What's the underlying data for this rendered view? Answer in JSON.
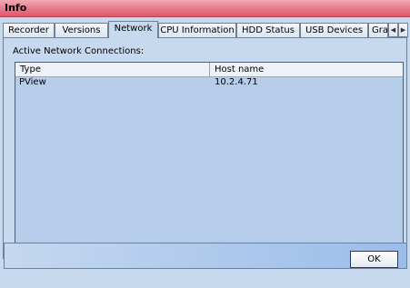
{
  "window": {
    "title": "Info"
  },
  "tabs": [
    {
      "label": "Recorder"
    },
    {
      "label": "Versions"
    },
    {
      "label": "Network"
    },
    {
      "label": "CPU Information"
    },
    {
      "label": "HDD Status"
    },
    {
      "label": "USB Devices"
    },
    {
      "label": "Gra"
    }
  ],
  "active_tab": "Network",
  "network": {
    "section_label": "Active Network Connections:",
    "columns": [
      "Type",
      "Host name"
    ],
    "rows": [
      {
        "type": "PView",
        "host": "10.2.4.71"
      }
    ]
  },
  "footer": {
    "ok_label": "OK"
  },
  "icons": {
    "tab_scroll_left": "chevron-left-icon",
    "tab_scroll_right": "chevron-right-icon"
  },
  "colors": {
    "titlebar": "#e8788a",
    "window_bg": "#c7d9ee",
    "list_bg": "#b5cceb"
  }
}
